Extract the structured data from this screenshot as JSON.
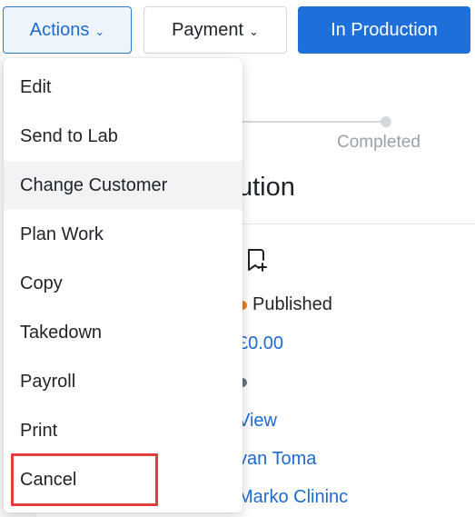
{
  "toolbar": {
    "actions_label": "Actions",
    "payment_label": "Payment",
    "production_label": "In Production"
  },
  "background": {
    "progress_label": "Completed",
    "section_title": "ution",
    "status_text": "Published",
    "status_color": "#f07a1e",
    "amount": "£0.00",
    "link_view": "View",
    "link_person": "van Toma",
    "link_clinic": "Marko Clininc"
  },
  "menu": {
    "items": [
      {
        "label": "Edit"
      },
      {
        "label": "Send to Lab"
      },
      {
        "label": "Change Customer"
      },
      {
        "label": "Plan Work"
      },
      {
        "label": "Copy"
      },
      {
        "label": "Takedown"
      },
      {
        "label": "Payroll"
      },
      {
        "label": "Print"
      },
      {
        "label": "Cancel"
      }
    ]
  },
  "colors": {
    "accent": "#1e6fd9",
    "highlight": "#e23c3c"
  }
}
